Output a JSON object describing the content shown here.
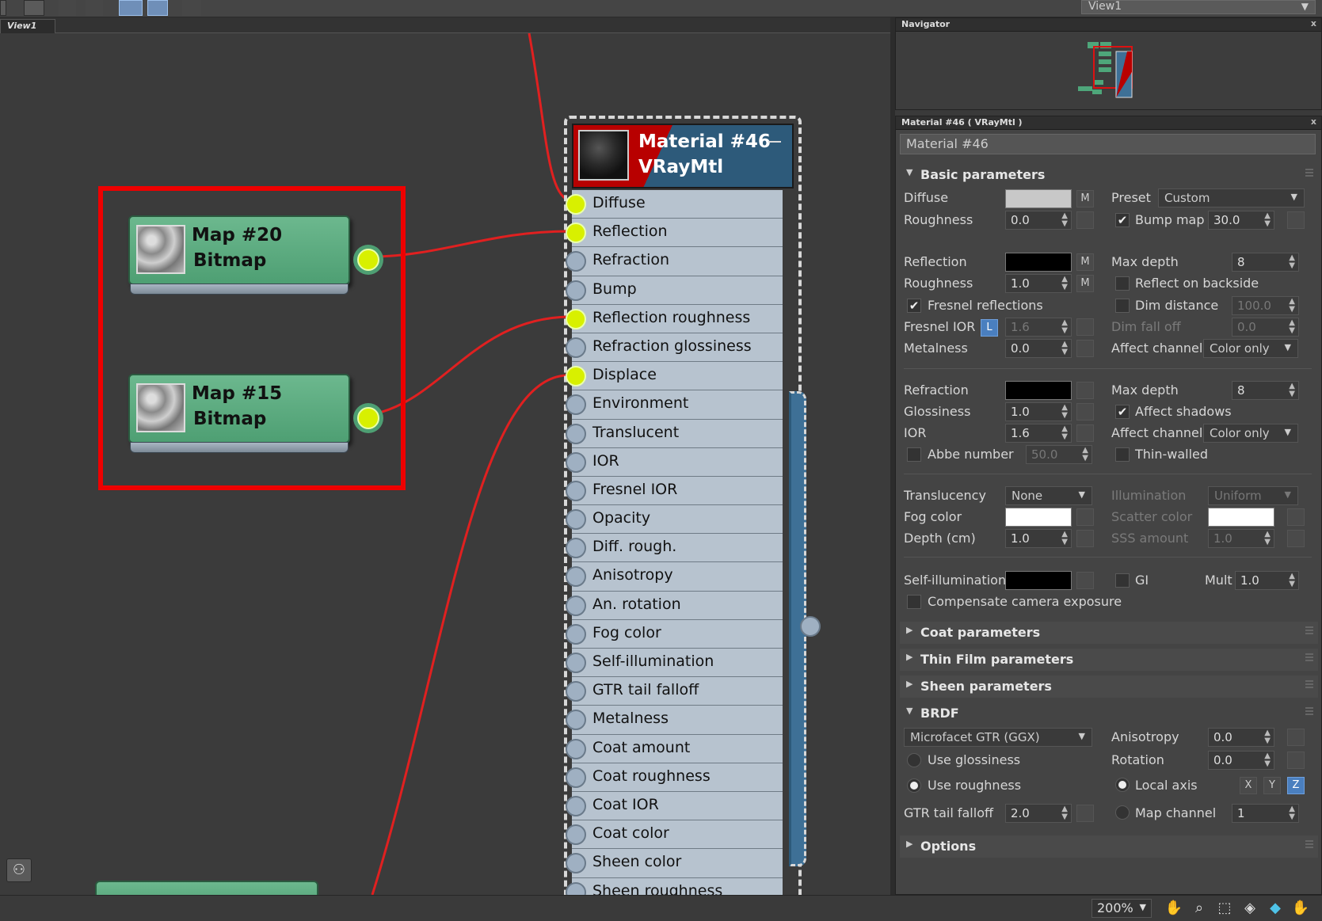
{
  "toolbar": {
    "view_select": "View1",
    "view_select_arrow": "▼"
  },
  "view_tab": "View1",
  "map_nodes": [
    {
      "title": "Map #20",
      "type": "Bitmap"
    },
    {
      "title": "Map #15",
      "type": "Bitmap"
    }
  ],
  "material_node": {
    "title": "Material #46",
    "type": "VRayMtl",
    "slots": [
      {
        "label": "Diffuse",
        "connected": true
      },
      {
        "label": "Reflection",
        "connected": true
      },
      {
        "label": "Refraction",
        "connected": false
      },
      {
        "label": "Bump",
        "connected": false
      },
      {
        "label": "Reflection roughness",
        "connected": true
      },
      {
        "label": "Refraction glossiness",
        "connected": false
      },
      {
        "label": "Displace",
        "connected": true
      },
      {
        "label": "Environment",
        "connected": false
      },
      {
        "label": "Translucent",
        "connected": false
      },
      {
        "label": "IOR",
        "connected": false
      },
      {
        "label": "Fresnel IOR",
        "connected": false
      },
      {
        "label": "Opacity",
        "connected": false
      },
      {
        "label": "Diff. rough.",
        "connected": false
      },
      {
        "label": "Anisotropy",
        "connected": false
      },
      {
        "label": "An. rotation",
        "connected": false
      },
      {
        "label": "Fog color",
        "connected": false
      },
      {
        "label": "Self-illumination",
        "connected": false
      },
      {
        "label": "GTR tail falloff",
        "connected": false
      },
      {
        "label": "Metalness",
        "connected": false
      },
      {
        "label": "Coat amount",
        "connected": false
      },
      {
        "label": "Coat roughness",
        "connected": false
      },
      {
        "label": "Coat IOR",
        "connected": false
      },
      {
        "label": "Coat color",
        "connected": false
      },
      {
        "label": "Sheen color",
        "connected": false
      },
      {
        "label": "Sheen roughness",
        "connected": false
      }
    ]
  },
  "navigator": {
    "title": "Navigator",
    "close": "x"
  },
  "params": {
    "title": "Material #46  ( VRayMtl )",
    "close": "x",
    "material_name": "Material #46",
    "rollouts": {
      "basic": "Basic parameters",
      "coat": "Coat parameters",
      "thin_film": "Thin Film parameters",
      "sheen": "Sheen parameters",
      "brdf": "BRDF",
      "options": "Options"
    },
    "basic": {
      "diffuse": "Diffuse",
      "preset": "Preset",
      "preset_value": "Custom",
      "roughness": "Roughness",
      "roughness_value": "0.0",
      "bump_map": "Bump map",
      "bump_map_value": "30.0",
      "reflection": "Reflection",
      "max_depth": "Max depth",
      "refl_max_depth_value": "8",
      "refl_roughness": "Roughness",
      "refl_roughness_value": "1.0",
      "reflect_backside": "Reflect on backside",
      "fresnel_reflections": "Fresnel reflections",
      "dim_distance": "Dim distance",
      "dim_distance_value": "100.0",
      "fresnel_ior": "Fresnel IOR",
      "fresnel_ior_lock": "L",
      "fresnel_ior_value": "1.6",
      "dim_fall_off": "Dim fall off",
      "dim_fall_off_value": "0.0",
      "metalness": "Metalness",
      "metalness_value": "0.0",
      "affect_channels": "Affect channels",
      "refl_affect_value": "Color only",
      "refraction": "Refraction",
      "refr_max_depth_value": "8",
      "glossiness": "Glossiness",
      "glossiness_value": "1.0",
      "affect_shadows": "Affect shadows",
      "ior": "IOR",
      "ior_value": "1.6",
      "refr_affect_value": "Color only",
      "abbe_number": "Abbe number",
      "abbe_value": "50.0",
      "thin_walled": "Thin-walled",
      "translucency": "Translucency",
      "translucency_value": "None",
      "illumination": "Illumination",
      "illumination_value": "Uniform",
      "fog_color": "Fog color",
      "scatter_color": "Scatter color",
      "depth_cm": "Depth (cm)",
      "depth_value": "1.0",
      "sss_amount": "SSS amount",
      "sss_value": "1.0",
      "self_illumination": "Self-illumination",
      "gi": "GI",
      "mult": "Mult",
      "mult_value": "1.0",
      "compensate": "Compensate camera exposure",
      "m": "M",
      "check": "✔"
    },
    "brdf": {
      "type_value": "Microfacet GTR (GGX)",
      "anisotropy": "Anisotropy",
      "anisotropy_value": "0.0",
      "use_glossiness": "Use glossiness",
      "rotation": "Rotation",
      "rotation_value": "0.0",
      "use_roughness": "Use roughness",
      "local_axis": "Local axis",
      "axis_x": "X",
      "axis_y": "Y",
      "axis_z": "Z",
      "gtr_tail_falloff": "GTR tail falloff",
      "gtr_value": "2.0",
      "map_channel": "Map channel",
      "map_channel_value": "1"
    }
  },
  "status": {
    "zoom": "200%",
    "zoom_arrow": "▼",
    "icons": [
      "pan-hand-icon",
      "zoom-magnifier-icon",
      "zoom-region-icon",
      "zoom-extents-icon",
      "zoom-selected-icon",
      "pan-view-icon"
    ]
  },
  "colors": {
    "selection_box": "#ee0000",
    "wire": "#e02020",
    "socket_active": "#d8f000",
    "diffuse_swatch": "#c8c8c8",
    "reflection_swatch": "#000000",
    "refraction_swatch": "#000000",
    "fog_swatch": "#ffffff",
    "scatter_swatch": "#ffffff",
    "selfillum_swatch": "#000000"
  }
}
